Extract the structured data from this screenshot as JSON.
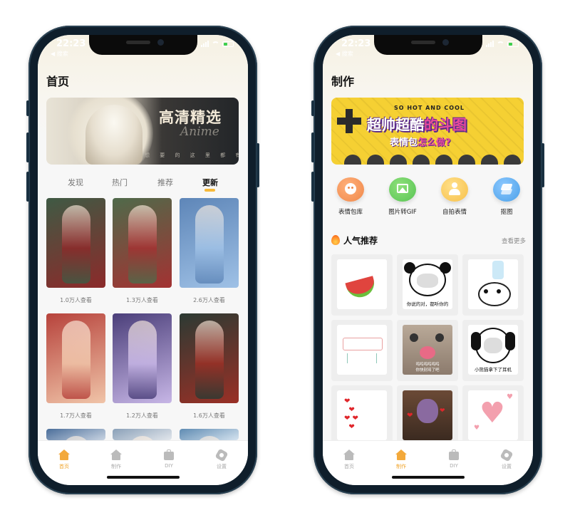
{
  "status": {
    "time": "22:23",
    "back_label": "搜索"
  },
  "home": {
    "title": "首页",
    "banner": {
      "title": "高清精选",
      "script": "Anime",
      "subtitle": "想 要 的 这 里 都 有"
    },
    "tabs": [
      "发现",
      "热门",
      "推荐",
      "更新"
    ],
    "active_tab": "更新",
    "cards": [
      {
        "views": "1.0万人查看",
        "colors": [
          "#3f5a44",
          "#8c2a2a"
        ]
      },
      {
        "views": "1.3万人查看",
        "colors": [
          "#4f6a4a",
          "#a33232"
        ]
      },
      {
        "views": "2.6万人查看",
        "colors": [
          "#5e86b8",
          "#9fc1e6"
        ]
      },
      {
        "views": "1.7万人查看",
        "colors": [
          "#b7433c",
          "#f0c4a8"
        ]
      },
      {
        "views": "1.2万人查看",
        "colors": [
          "#4b3f7a",
          "#c7b6e6"
        ]
      },
      {
        "views": "1.6万人查看",
        "colors": [
          "#2c3a33",
          "#9a3026"
        ]
      },
      {
        "views": "",
        "colors": [
          "#4b6e9a",
          "#c9d4e2"
        ]
      },
      {
        "views": "",
        "colors": [
          "#8aa0b8",
          "#e3e7ec"
        ]
      },
      {
        "views": "",
        "colors": [
          "#5f8bb2",
          "#d5e3ef"
        ]
      }
    ]
  },
  "make": {
    "title": "制作",
    "banner": {
      "small": "SO HOT AND COOL",
      "big_a": "超帅超酷",
      "big_b": "的斗图",
      "mid_a": "表情包",
      "mid_b": "怎么做?"
    },
    "tools": [
      {
        "label": "表情包库",
        "icon": "smiley-icon",
        "color": "#f0884a"
      },
      {
        "label": "图片转GIF",
        "icon": "image-icon",
        "color": "#58c454"
      },
      {
        "label": "自拍表情",
        "icon": "person-icon",
        "color": "#f7c04a"
      },
      {
        "label": "抠图",
        "icon": "layers-icon",
        "color": "#4aa0e8"
      }
    ],
    "section_title": "人气推荐",
    "more_label": "查看更多",
    "stickers": [
      {
        "caption": "",
        "kind": "watermelon"
      },
      {
        "caption": "你说的对，都听你的",
        "kind": "panda"
      },
      {
        "caption": "",
        "kind": "panda-water"
      },
      {
        "caption": "",
        "kind": "aircon"
      },
      {
        "caption": "呜呜呜呜呜呜\n你快别骂了吧",
        "kind": "cat"
      },
      {
        "caption": "小熊猫拿下了耳机",
        "kind": "panda2"
      },
      {
        "caption": "",
        "kind": "hearts"
      },
      {
        "caption": "",
        "kind": "thanos"
      },
      {
        "caption": "",
        "kind": "bigheart"
      }
    ]
  },
  "tabbar": [
    {
      "label": "首页",
      "icon": "home-icon"
    },
    {
      "label": "制作",
      "icon": "make-icon"
    },
    {
      "label": "DIY",
      "icon": "toolbox-icon"
    },
    {
      "label": "设置",
      "icon": "settings-icon"
    }
  ],
  "colors": {
    "accent": "#f3a93b",
    "accent_text": "#f0a52c"
  }
}
